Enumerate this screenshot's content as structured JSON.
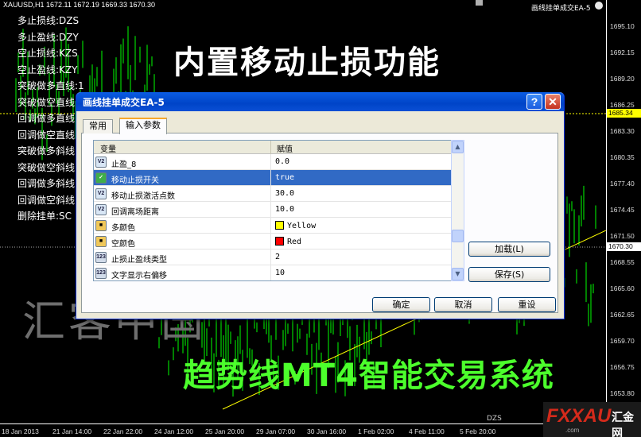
{
  "chart": {
    "symbol_info": "XAUUSD,H1  1672.11 1672.19 1669.33 1670.30",
    "ea_label": "画线挂单成交EA-5",
    "price_ticks": [
      "1695.10",
      "1692.15",
      "1689.20",
      "1686.25",
      "1683.30",
      "1680.35",
      "1677.40",
      "1674.45",
      "1671.50",
      "1668.55",
      "1665.60",
      "1662.65",
      "1659.70",
      "1656.75",
      "1653.80"
    ],
    "price_tag_upper": "1685.34",
    "price_tag_lower": "1670.30",
    "time_ticks": [
      "18 Jan 2013",
      "21 Jan 14:00",
      "22 Jan 22:00",
      "24 Jan 12:00",
      "25 Jan 20:00",
      "29 Jan 07:00",
      "30 Jan 16:00",
      "1 Feb 02:00",
      "4 Feb 11:00",
      "5 Feb 20:00"
    ],
    "legend": [
      "多止损线:DZS",
      "多止盈线:DZY",
      "空止损线:KZS",
      "空止盈线:KZY",
      "突破做多直线:1",
      "突破做空直线",
      "回调做多直线",
      "回调做空直线",
      "突破做多斜线",
      "突破做空斜线",
      "回调做多斜线",
      "回调做空斜线",
      "删除挂单:SC"
    ],
    "headline": "内置移动止损功能",
    "watermark": "汇客中国",
    "subheadline": "趋势线MT4智能交易系统",
    "bottom_tag": "DZS",
    "logo_text": "FXXAU",
    "logo_cn": "汇金网",
    "logo_url": ".com",
    "colors": {
      "green_candles": "#00ff00",
      "upper_price_line": "#ffff00",
      "trend_line": "#ffff00"
    }
  },
  "dialog": {
    "title": "画线挂单成交EA-5",
    "help_label": "?",
    "close_label": "✕",
    "tabs": [
      {
        "label": "常用"
      },
      {
        "label": "输入参数"
      }
    ],
    "grid": {
      "col_variable": "变量",
      "col_value": "赋值",
      "rows": [
        {
          "icon": "v2",
          "name": "止盈_8",
          "value": "0.0",
          "selected": false
        },
        {
          "icon": "bool",
          "name": "移动止损开关",
          "value": "true",
          "selected": true
        },
        {
          "icon": "v2",
          "name": "移动止损激活点数",
          "value": "30.0",
          "selected": false
        },
        {
          "icon": "v2",
          "name": "回调离场距离",
          "value": "10.0",
          "selected": false
        },
        {
          "icon": "color",
          "name": "多颜色",
          "value": "Yellow",
          "swatch": "#ffff00",
          "selected": false
        },
        {
          "icon": "color",
          "name": "空颜色",
          "value": "Red",
          "swatch": "#ff0000",
          "selected": false
        },
        {
          "icon": "123",
          "name": "止损止盈线类型",
          "value": "2",
          "selected": false
        },
        {
          "icon": "123",
          "name": "文字显示右偏移",
          "value": "10",
          "selected": false
        }
      ]
    },
    "load_button": "加载(L)",
    "save_button": "保存(S)",
    "ok_button": "确定",
    "cancel_button": "取消",
    "reset_button": "重设"
  }
}
